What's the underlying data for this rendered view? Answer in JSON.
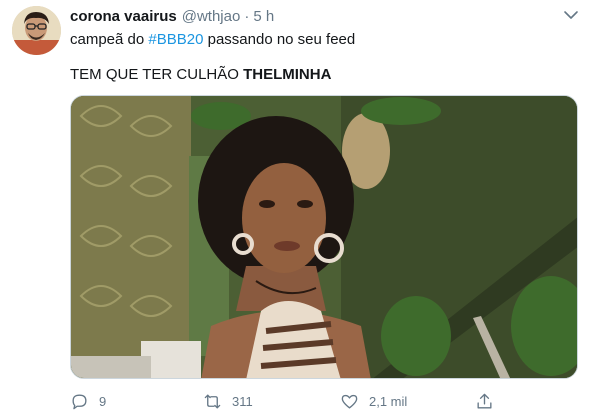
{
  "tweet": {
    "author": {
      "name": "corona vaairus",
      "handle": "@wthjao",
      "avatar_icon": "avatar-photo"
    },
    "separator": "·",
    "time": "5 h",
    "line1_before": "campeã do ",
    "hashtag": "#BBB20",
    "line1_after": " passando no seu feed",
    "line2_plain": "TEM QUE TER CULHÃO ",
    "line2_bold": "THELMINHA",
    "media_icon": "photo-woman-curly-hair-green-room",
    "actions": {
      "reply_icon": "reply-icon",
      "reply_count": "9",
      "retweet_icon": "retweet-icon",
      "retweet_count": "311",
      "like_icon": "heart-icon",
      "like_count": "2,1 mil",
      "share_icon": "share-icon"
    },
    "colors": {
      "link": "#1b95e0",
      "secondary_text": "#657786",
      "primary_text": "#14171a"
    }
  }
}
